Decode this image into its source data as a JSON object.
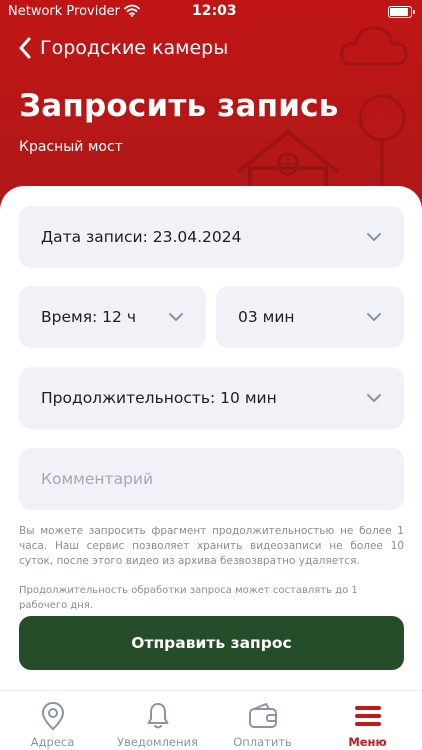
{
  "status_bar": {
    "carrier": "Network Provider",
    "time": "12:03",
    "battery_level": 0.95
  },
  "nav": {
    "back_label": "Городские камеры"
  },
  "page": {
    "title": "Запросить запись",
    "subtitle": "Красный мост"
  },
  "form": {
    "date_field": "Дата записи: 23.04.2024",
    "hour_field": "Время: 12 ч",
    "minute_field": "03 мин",
    "duration_field": "Продолжительность: 10 мин",
    "comment_placeholder": "Комментарий",
    "hint_main": "Вы можете запросить фрагмент продолжительностью не более 1 часа. Наш сервис позволяет хранить видеозаписи не более 10 суток, после этого видео из архива безвозвратно удаляется.",
    "hint_processing": "Продолжительность обработки запроса может составлять до 1 рабочего дня.",
    "submit_label": "Отправить запрос"
  },
  "tabbar": {
    "items": [
      {
        "label": "Адреса",
        "icon": "map-pin-icon"
      },
      {
        "label": "Уведомления",
        "icon": "bell-icon"
      },
      {
        "label": "Оплатить",
        "icon": "wallet-icon"
      },
      {
        "label": "Меню",
        "icon": "menu-icon"
      }
    ],
    "active_index": 3
  },
  "colors": {
    "header": "#b81717",
    "field_bg": "#f1f2f8",
    "submit_bg": "#264d2a",
    "active_tab": "#c01a1a",
    "inactive_tab": "#8d93a5"
  }
}
